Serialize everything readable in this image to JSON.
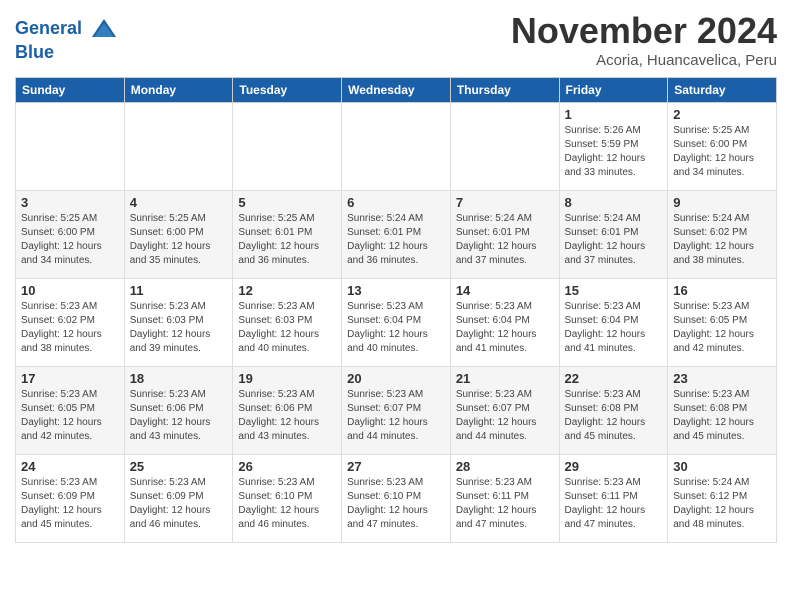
{
  "header": {
    "logo_line1": "General",
    "logo_line2": "Blue",
    "month": "November 2024",
    "location": "Acoria, Huancavelica, Peru"
  },
  "weekdays": [
    "Sunday",
    "Monday",
    "Tuesday",
    "Wednesday",
    "Thursday",
    "Friday",
    "Saturday"
  ],
  "weeks": [
    [
      {
        "day": "",
        "info": ""
      },
      {
        "day": "",
        "info": ""
      },
      {
        "day": "",
        "info": ""
      },
      {
        "day": "",
        "info": ""
      },
      {
        "day": "",
        "info": ""
      },
      {
        "day": "1",
        "info": "Sunrise: 5:26 AM\nSunset: 5:59 PM\nDaylight: 12 hours\nand 33 minutes."
      },
      {
        "day": "2",
        "info": "Sunrise: 5:25 AM\nSunset: 6:00 PM\nDaylight: 12 hours\nand 34 minutes."
      }
    ],
    [
      {
        "day": "3",
        "info": "Sunrise: 5:25 AM\nSunset: 6:00 PM\nDaylight: 12 hours\nand 34 minutes."
      },
      {
        "day": "4",
        "info": "Sunrise: 5:25 AM\nSunset: 6:00 PM\nDaylight: 12 hours\nand 35 minutes."
      },
      {
        "day": "5",
        "info": "Sunrise: 5:25 AM\nSunset: 6:01 PM\nDaylight: 12 hours\nand 36 minutes."
      },
      {
        "day": "6",
        "info": "Sunrise: 5:24 AM\nSunset: 6:01 PM\nDaylight: 12 hours\nand 36 minutes."
      },
      {
        "day": "7",
        "info": "Sunrise: 5:24 AM\nSunset: 6:01 PM\nDaylight: 12 hours\nand 37 minutes."
      },
      {
        "day": "8",
        "info": "Sunrise: 5:24 AM\nSunset: 6:01 PM\nDaylight: 12 hours\nand 37 minutes."
      },
      {
        "day": "9",
        "info": "Sunrise: 5:24 AM\nSunset: 6:02 PM\nDaylight: 12 hours\nand 38 minutes."
      }
    ],
    [
      {
        "day": "10",
        "info": "Sunrise: 5:23 AM\nSunset: 6:02 PM\nDaylight: 12 hours\nand 38 minutes."
      },
      {
        "day": "11",
        "info": "Sunrise: 5:23 AM\nSunset: 6:03 PM\nDaylight: 12 hours\nand 39 minutes."
      },
      {
        "day": "12",
        "info": "Sunrise: 5:23 AM\nSunset: 6:03 PM\nDaylight: 12 hours\nand 40 minutes."
      },
      {
        "day": "13",
        "info": "Sunrise: 5:23 AM\nSunset: 6:04 PM\nDaylight: 12 hours\nand 40 minutes."
      },
      {
        "day": "14",
        "info": "Sunrise: 5:23 AM\nSunset: 6:04 PM\nDaylight: 12 hours\nand 41 minutes."
      },
      {
        "day": "15",
        "info": "Sunrise: 5:23 AM\nSunset: 6:04 PM\nDaylight: 12 hours\nand 41 minutes."
      },
      {
        "day": "16",
        "info": "Sunrise: 5:23 AM\nSunset: 6:05 PM\nDaylight: 12 hours\nand 42 minutes."
      }
    ],
    [
      {
        "day": "17",
        "info": "Sunrise: 5:23 AM\nSunset: 6:05 PM\nDaylight: 12 hours\nand 42 minutes."
      },
      {
        "day": "18",
        "info": "Sunrise: 5:23 AM\nSunset: 6:06 PM\nDaylight: 12 hours\nand 43 minutes."
      },
      {
        "day": "19",
        "info": "Sunrise: 5:23 AM\nSunset: 6:06 PM\nDaylight: 12 hours\nand 43 minutes."
      },
      {
        "day": "20",
        "info": "Sunrise: 5:23 AM\nSunset: 6:07 PM\nDaylight: 12 hours\nand 44 minutes."
      },
      {
        "day": "21",
        "info": "Sunrise: 5:23 AM\nSunset: 6:07 PM\nDaylight: 12 hours\nand 44 minutes."
      },
      {
        "day": "22",
        "info": "Sunrise: 5:23 AM\nSunset: 6:08 PM\nDaylight: 12 hours\nand 45 minutes."
      },
      {
        "day": "23",
        "info": "Sunrise: 5:23 AM\nSunset: 6:08 PM\nDaylight: 12 hours\nand 45 minutes."
      }
    ],
    [
      {
        "day": "24",
        "info": "Sunrise: 5:23 AM\nSunset: 6:09 PM\nDaylight: 12 hours\nand 45 minutes."
      },
      {
        "day": "25",
        "info": "Sunrise: 5:23 AM\nSunset: 6:09 PM\nDaylight: 12 hours\nand 46 minutes."
      },
      {
        "day": "26",
        "info": "Sunrise: 5:23 AM\nSunset: 6:10 PM\nDaylight: 12 hours\nand 46 minutes."
      },
      {
        "day": "27",
        "info": "Sunrise: 5:23 AM\nSunset: 6:10 PM\nDaylight: 12 hours\nand 47 minutes."
      },
      {
        "day": "28",
        "info": "Sunrise: 5:23 AM\nSunset: 6:11 PM\nDaylight: 12 hours\nand 47 minutes."
      },
      {
        "day": "29",
        "info": "Sunrise: 5:23 AM\nSunset: 6:11 PM\nDaylight: 12 hours\nand 47 minutes."
      },
      {
        "day": "30",
        "info": "Sunrise: 5:24 AM\nSunset: 6:12 PM\nDaylight: 12 hours\nand 48 minutes."
      }
    ]
  ]
}
